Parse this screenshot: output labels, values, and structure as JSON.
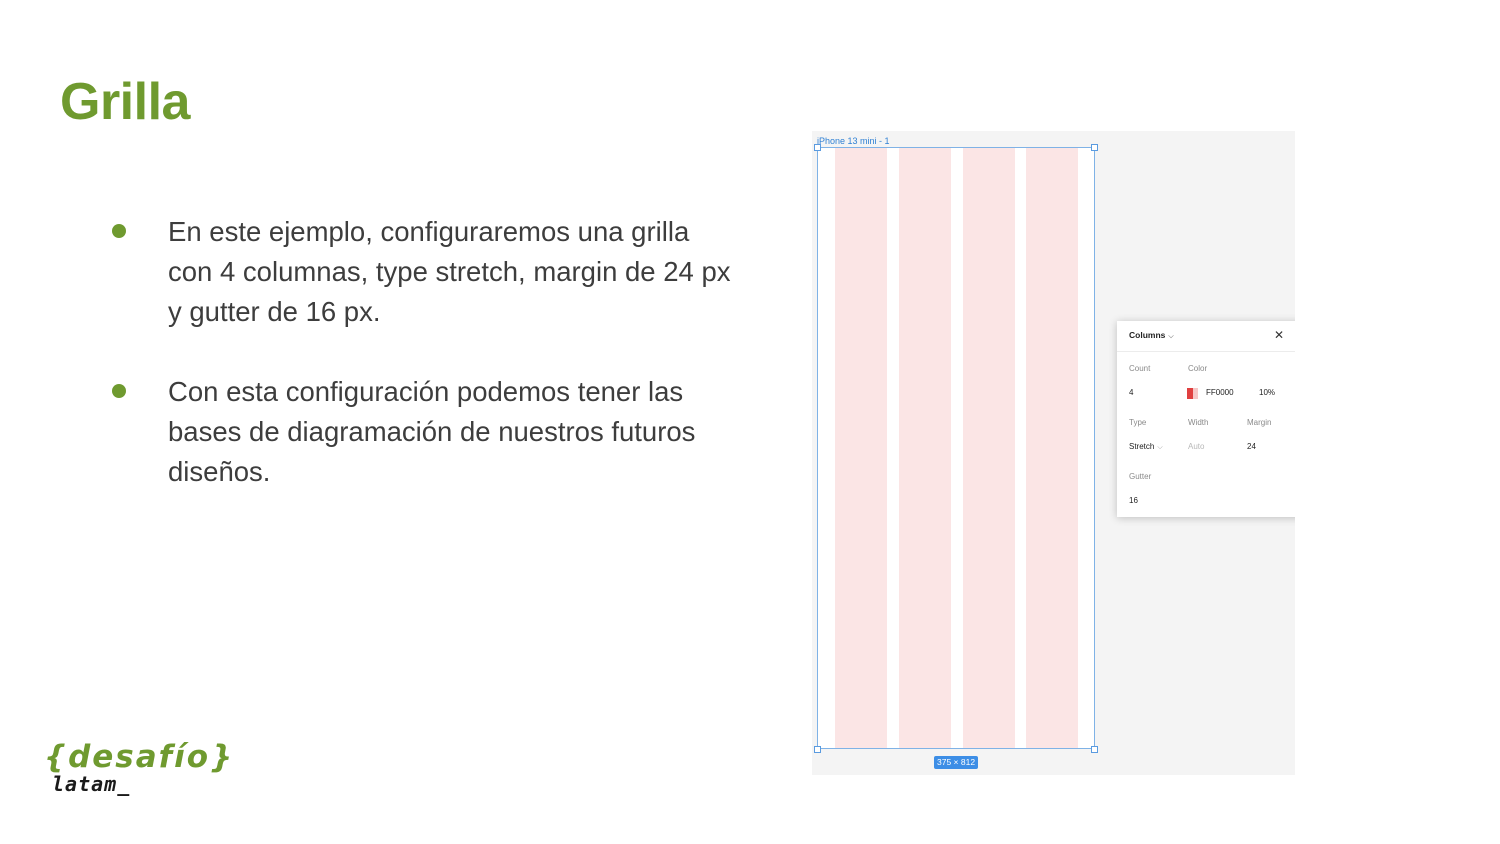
{
  "slide": {
    "title": "Grilla",
    "bullets": [
      "En este ejemplo, configuraremos una grilla con 4 columnas, type stretch, margin de 24 px y gutter de 16 px.",
      "Con esta configuración podemos tener las bases de diagramación de nuestros futuros diseños."
    ],
    "accent_color": "#6f9a2f"
  },
  "logo": {
    "top_text": "{desafío}",
    "bottom_text": "latam_"
  },
  "figma": {
    "frame_label": "iPhone 13 mini - 1",
    "frame_size": "375 × 812",
    "column_color": "#fbe5e5",
    "panel": {
      "title": "Columns",
      "count_label": "Count",
      "count_value": "4",
      "color_label": "Color",
      "color_value": "FF0000",
      "opacity_value": "10%",
      "type_label": "Type",
      "type_value": "Stretch",
      "width_label": "Width",
      "width_value": "Auto",
      "margin_label": "Margin",
      "margin_value": "24",
      "gutter_label": "Gutter",
      "gutter_value": "16"
    }
  }
}
